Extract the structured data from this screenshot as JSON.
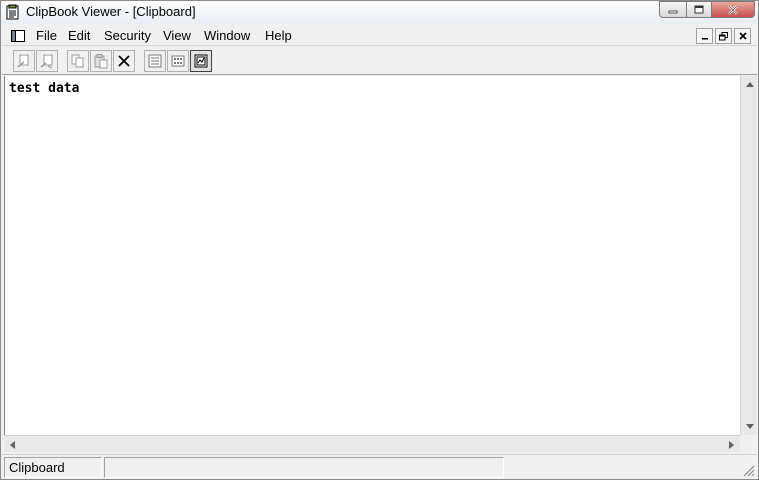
{
  "window": {
    "title": "ClipBook Viewer - [Clipboard]"
  },
  "menu": {
    "items": [
      {
        "label": "File"
      },
      {
        "label": "Edit"
      },
      {
        "label": "Security"
      },
      {
        "label": "View"
      },
      {
        "label": "Window"
      },
      {
        "label": "Help"
      }
    ]
  },
  "toolbar": {
    "buttons": [
      {
        "icon": "connect-icon"
      },
      {
        "icon": "disconnect-icon"
      },
      {
        "icon": "copy-icon"
      },
      {
        "icon": "paste-icon"
      },
      {
        "icon": "delete-icon"
      },
      {
        "icon": "table-of-contents-icon"
      },
      {
        "icon": "thumbnails-icon"
      },
      {
        "icon": "full-page-icon",
        "pressed": true
      }
    ]
  },
  "content": {
    "text": "test data"
  },
  "status": {
    "pane1": "Clipboard",
    "pane2": ""
  },
  "colors": {
    "close_button": "#c75050",
    "window_bg": "#f0f0f0",
    "content_bg": "#ffffff"
  }
}
